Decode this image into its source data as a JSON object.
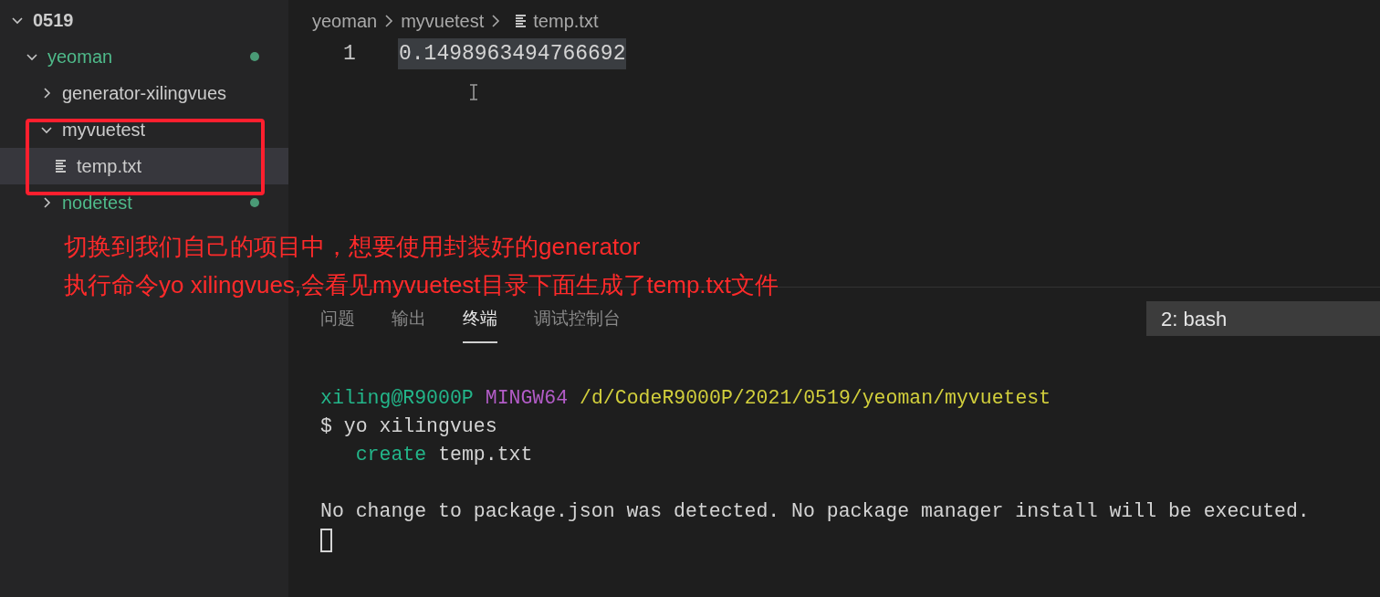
{
  "explorer": {
    "tree": [
      {
        "label": "0519",
        "kind": "folder",
        "expanded": true,
        "changed": false,
        "selected": false,
        "children": [
          {
            "label": "yeoman",
            "kind": "folder",
            "expanded": true,
            "changed": true,
            "selected": false,
            "children": [
              {
                "label": "generator-xilingvues",
                "kind": "folder",
                "expanded": false,
                "changed": false,
                "selected": false
              },
              {
                "label": "myvuetest",
                "kind": "folder",
                "expanded": true,
                "changed": false,
                "selected": false,
                "children": [
                  {
                    "label": "temp.txt",
                    "kind": "file",
                    "changed": false,
                    "selected": true
                  }
                ]
              },
              {
                "label": "nodetest",
                "kind": "folder",
                "expanded": false,
                "changed": true,
                "selected": false
              }
            ]
          }
        ]
      }
    ]
  },
  "editor": {
    "breadcrumb": [
      {
        "label": "yeoman",
        "kind": "folder"
      },
      {
        "label": "myvuetest",
        "kind": "folder"
      },
      {
        "label": "temp.txt",
        "kind": "file"
      }
    ],
    "lines": [
      {
        "number": "1",
        "text": "0.1498963494766692",
        "selected": true
      }
    ]
  },
  "panel": {
    "tabs": [
      {
        "label": "问题",
        "selected": false
      },
      {
        "label": "输出",
        "selected": false
      },
      {
        "label": "终端",
        "selected": true
      },
      {
        "label": "调试控制台",
        "selected": false
      }
    ],
    "terminal_select": "2: bash",
    "terminal_lines": [
      {
        "segments": [
          {
            "text": "xiling@R9000P",
            "color": "#23b68a"
          },
          {
            "text": "MINGW64",
            "color": "#b35cc8"
          },
          {
            "text": "/d/CodeR9000P/2021/0519/yeoman/myvuetest",
            "color": "#d2cf3c"
          }
        ]
      },
      {
        "segments": [
          {
            "text": "$ yo xilingvues",
            "color": "#d4d4d4"
          }
        ]
      },
      {
        "segments": [
          {
            "text": "   create",
            "color": "#23b68a"
          },
          {
            "text": "temp.txt",
            "color": "#d4d4d4"
          }
        ]
      }
    ],
    "terminal_notice": "No change to package.json was detected. No package manager install will be executed."
  },
  "annotation": {
    "lines": [
      "切换到我们自己的项目中，想要使用封装好的generator",
      "执行命令yo xilingvues,会看见myvuetest目录下面生成了temp.txt文件"
    ]
  }
}
